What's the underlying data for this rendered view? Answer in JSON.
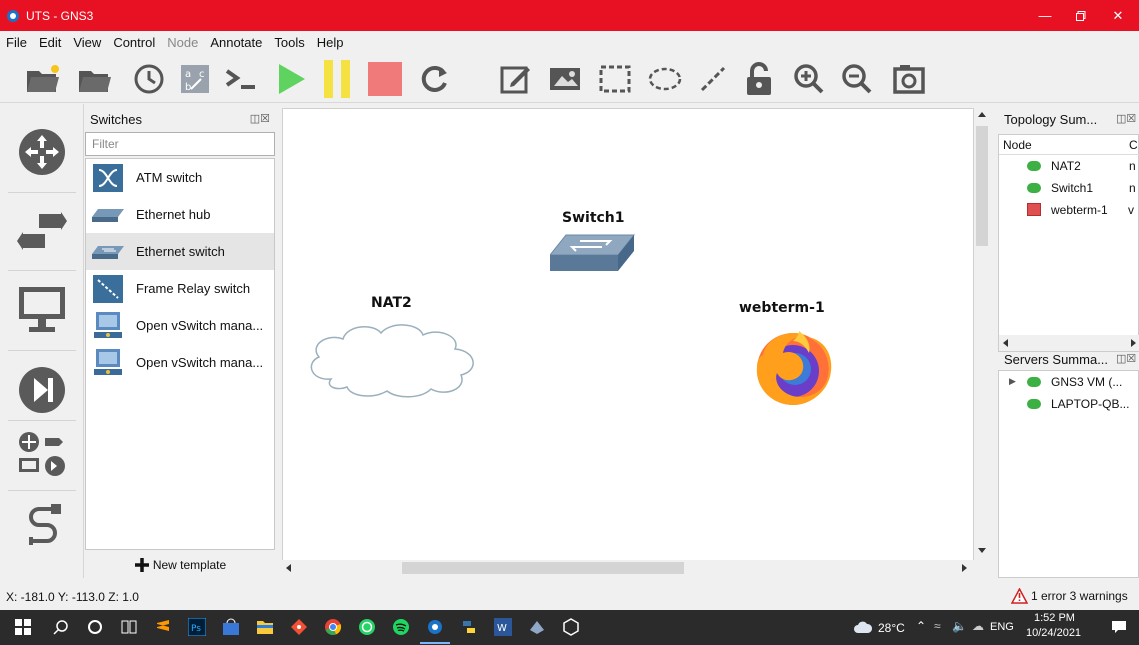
{
  "window": {
    "title": "UTS - GNS3"
  },
  "menu": {
    "items": [
      {
        "label": "File",
        "enabled": true
      },
      {
        "label": "Edit",
        "enabled": true
      },
      {
        "label": "View",
        "enabled": true
      },
      {
        "label": "Control",
        "enabled": true
      },
      {
        "label": "Node",
        "enabled": false
      },
      {
        "label": "Annotate",
        "enabled": true
      },
      {
        "label": "Tools",
        "enabled": true
      },
      {
        "label": "Help",
        "enabled": true
      }
    ]
  },
  "toolbar": {
    "buttons": [
      "open-project",
      "open-folder",
      "snapshot",
      "show-interface-labels",
      "console-all",
      "start-all",
      "suspend-all",
      "stop-all",
      "reload-all",
      "add-note",
      "insert-image",
      "draw-rectangle",
      "draw-ellipse",
      "draw-line",
      "unlock",
      "zoom-in",
      "zoom-out",
      "screenshot"
    ]
  },
  "device_panel": {
    "title": "Switches",
    "filter_placeholder": "Filter",
    "items": [
      {
        "label": "ATM switch",
        "icon": "atm-switch-icon"
      },
      {
        "label": "Ethernet hub",
        "icon": "ethernet-hub-icon"
      },
      {
        "label": "Ethernet switch",
        "icon": "ethernet-switch-icon",
        "selected": true
      },
      {
        "label": "Frame Relay switch",
        "icon": "frame-relay-icon"
      },
      {
        "label": "Open vSwitch mana...",
        "icon": "ovs-icon"
      },
      {
        "label": "Open vSwitch mana...",
        "icon": "ovs-icon"
      }
    ],
    "new_template": "New template"
  },
  "canvas": {
    "nodes": [
      {
        "name": "Switch1",
        "type": "switch"
      },
      {
        "name": "NAT2",
        "type": "cloud"
      },
      {
        "name": "webterm-1",
        "type": "firefox"
      }
    ]
  },
  "topology_summary": {
    "title": "Topology Sum...",
    "columns": [
      "Node",
      "C"
    ],
    "rows": [
      {
        "name": "NAT2",
        "status": "started",
        "console": "n",
        "status_color": "#3cb043"
      },
      {
        "name": "Switch1",
        "status": "started",
        "console": "n",
        "status_color": "#3cb043"
      },
      {
        "name": "webterm-1",
        "status": "stopped",
        "console": "v",
        "status_color": "#e05050"
      }
    ]
  },
  "servers_summary": {
    "title": "Servers Summa...",
    "servers": [
      {
        "name": "GNS3 VM (...",
        "expandable": true
      },
      {
        "name": "LAPTOP-QB...",
        "expandable": false
      }
    ]
  },
  "status": {
    "coordinates": "X: -181.0 Y: -113.0 Z: 1.0",
    "errors": "1 error 3 warnings"
  },
  "taskbar": {
    "weather": "28°C",
    "language": "ENG",
    "time": "1:52 PM",
    "date": "10/24/2021"
  }
}
